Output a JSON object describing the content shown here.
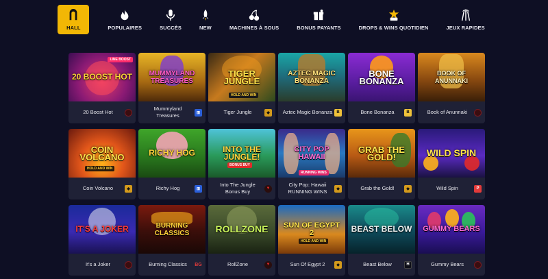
{
  "nav": {
    "items": [
      {
        "label": "HALL",
        "icon": "hall-icon",
        "active": true
      },
      {
        "label": "POPULAIRES",
        "icon": "flame-icon",
        "active": false
      },
      {
        "label": "SUCCÈS",
        "icon": "microphone-icon",
        "active": false
      },
      {
        "label": "NEW",
        "icon": "rocket-icon",
        "active": false
      },
      {
        "label": "MACHINES À SOUS",
        "icon": "cherries-icon",
        "active": false
      },
      {
        "label": "BONUS PAYANTS",
        "icon": "gift-box-icon",
        "active": false
      },
      {
        "label": "DROPS & WINS QUOTIDIEN",
        "icon": "drops-wins-icon",
        "active": false
      },
      {
        "label": "JEUX RAPIDES",
        "icon": "fireworks-icon",
        "active": false
      }
    ]
  },
  "colors": {
    "background": "#0e0f24",
    "card": "#1f2136",
    "accent": "#f2b705"
  },
  "games": [
    {
      "name": "20 Boost Hot",
      "art": "20 BOOST HOT",
      "art_tag": "LINE BOOST",
      "provider": "dark-round-provider-icon"
    },
    {
      "name": "Mummyland Treasures",
      "art": "MUMMYLAND TREASURES",
      "art_tag": "",
      "provider": "blue-grid-provider-icon"
    },
    {
      "name": "Tiger Jungle",
      "art": "TIGER JUNGLE",
      "art_tag": "HOLD AND WIN",
      "provider": "gold-shield-provider-icon"
    },
    {
      "name": "Aztec Magic Bonanza",
      "art": "AZTEC MAGIC BONANZA",
      "art_tag": "",
      "provider": "b-provider-icon"
    },
    {
      "name": "Bone Bonanza",
      "art": "BONE BONANZA",
      "art_tag": "",
      "provider": "b-provider-icon"
    },
    {
      "name": "Book of Anunnaki",
      "art": "BOOK OF ANUNNAKI",
      "art_tag": "",
      "provider": "dark-round-provider-icon"
    },
    {
      "name": "Coin Volcano",
      "art": "COIN VOLCANO",
      "art_tag": "HOLD AND WIN",
      "provider": "gold-shield-provider-icon"
    },
    {
      "name": "Richy Hog",
      "art": "RICHY HOG",
      "art_tag": "",
      "provider": "blue-grid-provider-icon"
    },
    {
      "name": "Into The Jungle Bonus Buy",
      "art": "INTO THE JUNGLE!",
      "art_tag": "BONUS BUY",
      "provider": "red-arrow-provider-icon"
    },
    {
      "name": "City Pop: Hawaii RUNNING WINS",
      "art": "CITY POP HAWAII",
      "art_tag": "RUNNING WINS",
      "provider": "gold-shield-provider-icon"
    },
    {
      "name": "Grab the Gold!",
      "art": "GRAB THE GOLD!",
      "art_tag": "",
      "provider": "gold-shield-provider-icon"
    },
    {
      "name": "Wild Spin",
      "art": "WILD SPIN",
      "art_tag": "",
      "provider": "p-provider-icon"
    },
    {
      "name": "It's a Joker",
      "art": "IT'S A JOKER",
      "art_tag": "",
      "provider": "dark-round-provider-icon"
    },
    {
      "name": "Burning Classics",
      "art": "BURNING CLASSICS",
      "art_tag": "",
      "provider": "bg-provider-icon"
    },
    {
      "name": "RollZone",
      "art": "ROLLZONE",
      "art_tag": "",
      "provider": "red-arrow-provider-icon"
    },
    {
      "name": "Sun Of Egypt 2",
      "art": "SUN OF EGYPT 2",
      "art_tag": "HOLD AND WIN",
      "provider": "gold-shield-provider-icon"
    },
    {
      "name": "Beast Below",
      "art": "BEAST BELOW",
      "art_tag": "",
      "provider": "h-provider-icon"
    },
    {
      "name": "Gummy Bears",
      "art": "GUMMY BEARS",
      "art_tag": "",
      "provider": "dark-round-provider-icon"
    }
  ]
}
